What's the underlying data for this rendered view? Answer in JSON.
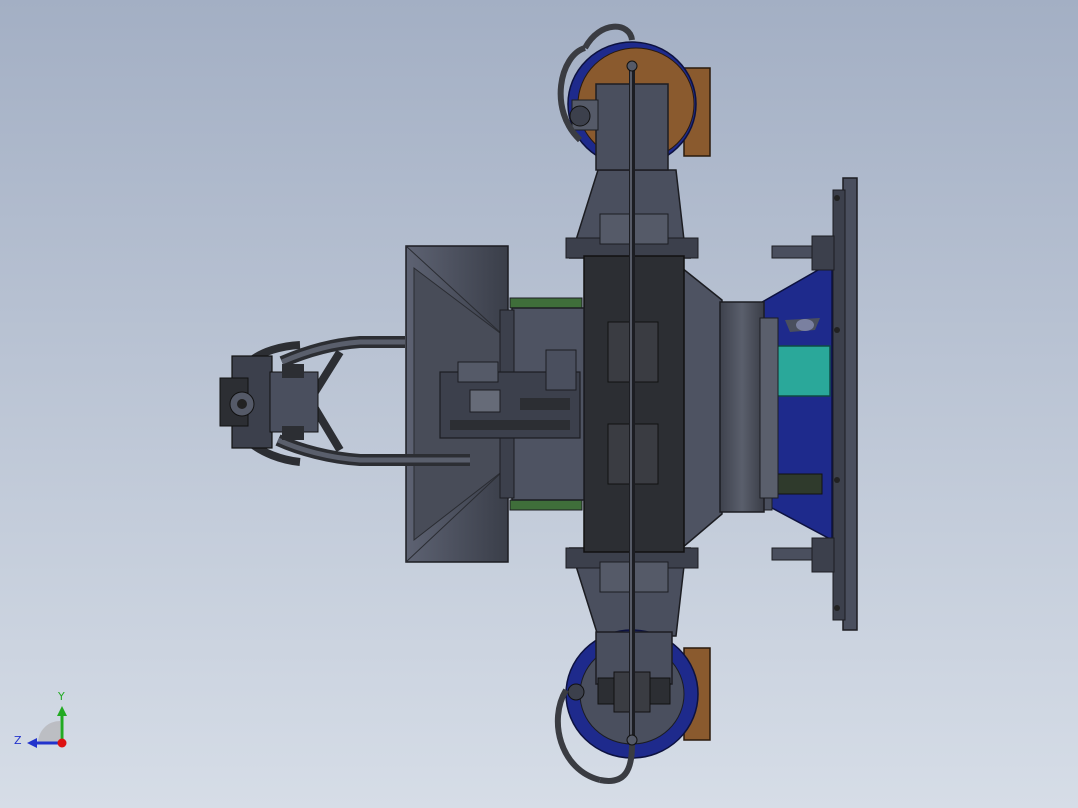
{
  "axis_triad": {
    "y_label": "Y",
    "z_label": "Z",
    "y_color": "#22aa22",
    "z_color": "#2233cc",
    "x_color": "#dd1111"
  },
  "palette": {
    "background_top": "#a3afc4",
    "background_bottom": "#d6dde7",
    "frame_gray": "#4a4f5e",
    "dark_panel": "#2c2e33",
    "navy_blue": "#1e2a8c",
    "bronze": "#8a5a2e",
    "teal": "#2aa89a",
    "green_trim": "#3f6e3a",
    "hose": "#3a3c42"
  }
}
